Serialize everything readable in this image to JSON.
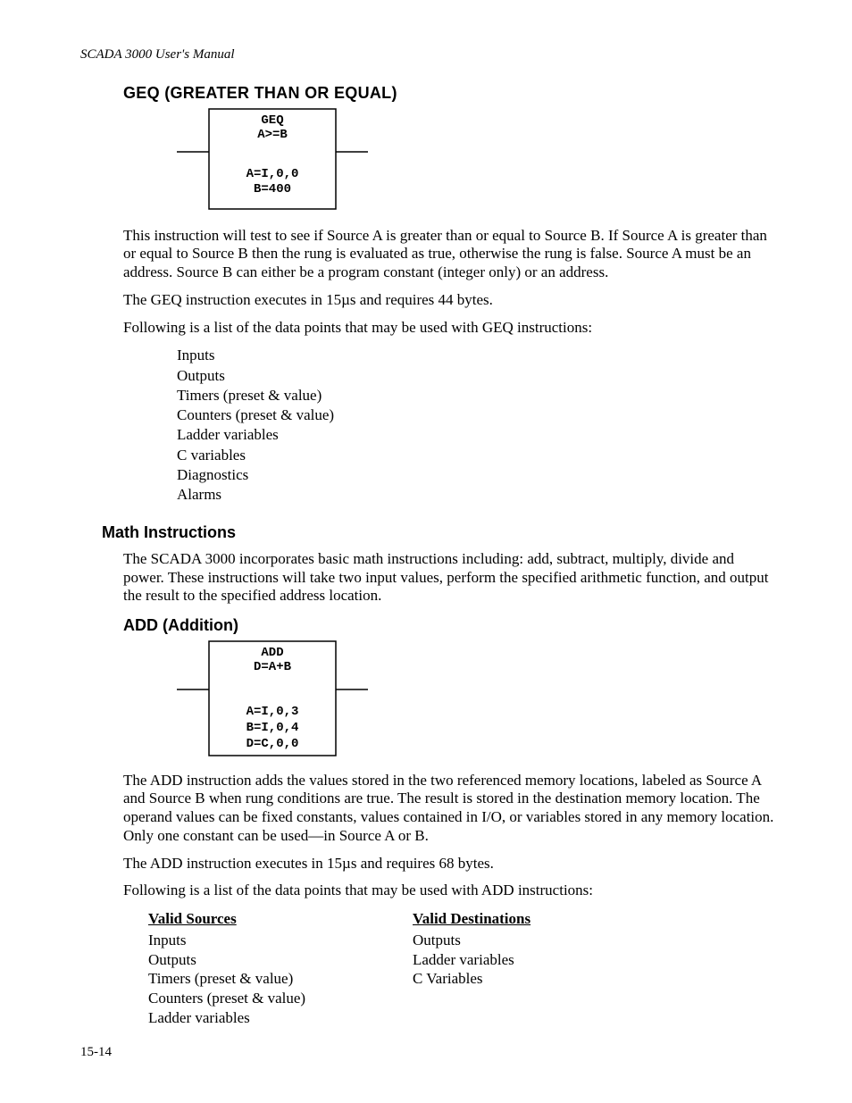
{
  "header": {
    "running": "SCADA 3000 User's Manual"
  },
  "geq": {
    "title": "GEQ  (GREATER THAN OR EQUAL)",
    "box": {
      "name": "GEQ",
      "expr": "A>=B",
      "a": "A=I,0,0",
      "b": "B=400"
    },
    "para1": "This instruction will test to see if Source A is greater than or equal to Source B.  If Source A is greater than or equal to Source B then the rung is evaluated as true, otherwise the rung is false.  Source A must be an address.   Source B can either be a program constant (integer only) or an address.",
    "para2": "The GEQ instruction executes in 15µs and requires 44 bytes.",
    "para3": "Following is a list of the data points that may be used with GEQ instructions:",
    "points": [
      "Inputs",
      "Outputs",
      "Timers (preset & value)",
      "Counters (preset & value)",
      "Ladder variables",
      "C variables",
      "Diagnostics",
      "Alarms"
    ]
  },
  "math": {
    "title": "Math Instructions",
    "para": "The SCADA 3000 incorporates basic math instructions including: add, subtract, multiply, divide and power.  These instructions will take two input values, perform the specified arithmetic function, and output the result to the specified address location."
  },
  "add": {
    "title": "ADD  (Addition)",
    "box": {
      "name": "ADD",
      "expr": "D=A+B",
      "a": "A=I,0,3",
      "b": "B=I,0,4",
      "d": "D=C,0,0"
    },
    "para1": "The ADD instruction adds the values stored in the two referenced memory locations, labeled as Source A and Source B when rung conditions are true.  The result is stored in the destination memory location.  The operand values can be fixed constants, values contained in I/O, or variables stored in any memory location. Only one constant can be used—in Source A or B.",
    "para2": "The ADD instruction executes in 15µs and requires 68 bytes.",
    "para3": "Following is a list of the data points that may be used with ADD instructions:",
    "sources_hdr": "Valid Sources",
    "dest_hdr": "Valid Destinations",
    "sources": [
      "Inputs",
      "Outputs",
      "Timers (preset & value)",
      "Counters (preset & value)",
      "Ladder variables"
    ],
    "dests": [
      "Outputs",
      "Ladder variables",
      "C Variables"
    ]
  },
  "footer": {
    "page": "15-14"
  }
}
